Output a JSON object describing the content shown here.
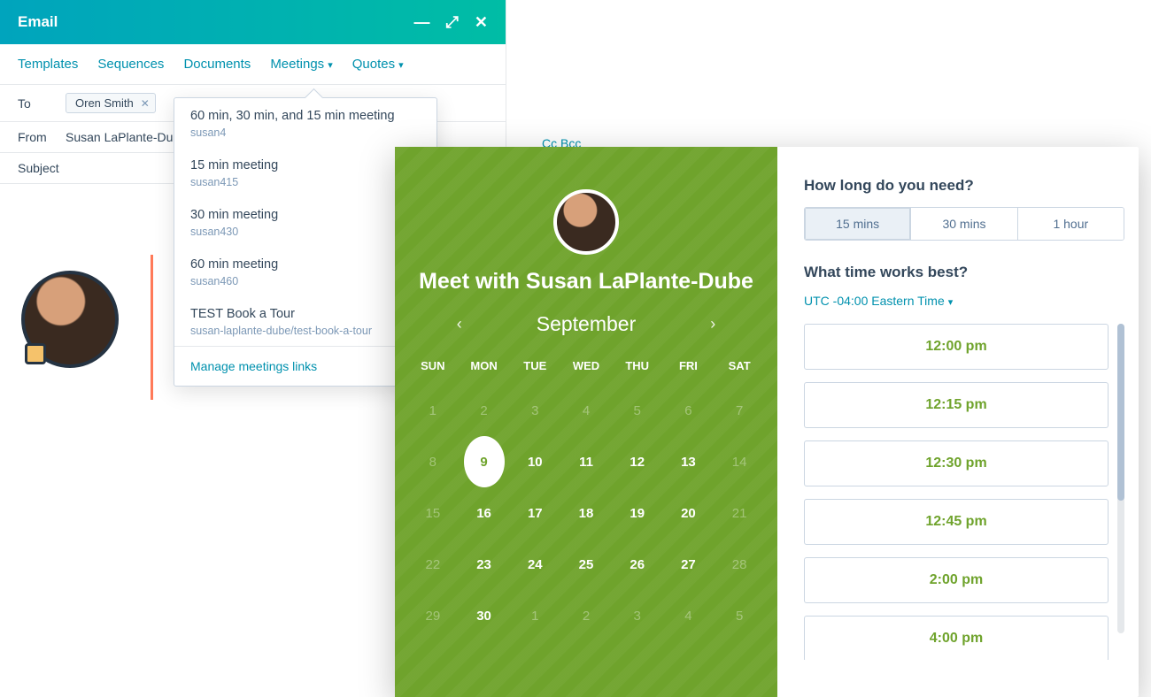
{
  "email": {
    "title": "Email",
    "toolbar": {
      "templates": "Templates",
      "sequences": "Sequences",
      "documents": "Documents",
      "meetings": "Meetings",
      "quotes": "Quotes"
    },
    "to_label": "To",
    "recipient": "Oren Smith",
    "from_label": "From",
    "from_value": "Susan LaPlante-Dub",
    "subject_label": "Subject",
    "cc_bcc": "Cc Bcc"
  },
  "meetings_dropdown": {
    "items": [
      {
        "title": "60 min, 30 min, and 15 min meeting",
        "sub": "susan4"
      },
      {
        "title": "15 min meeting",
        "sub": "susan415"
      },
      {
        "title": "30 min meeting",
        "sub": "susan430"
      },
      {
        "title": "60 min meeting",
        "sub": "susan460"
      },
      {
        "title": "TEST Book a Tour",
        "sub": "susan-laplante-dube/test-book-a-tour"
      }
    ],
    "manage": "Manage meetings links"
  },
  "booking": {
    "title": "Meet with Susan LaPlante-Dube",
    "month": "September",
    "dow": [
      "SUN",
      "MON",
      "TUE",
      "WED",
      "THU",
      "FRI",
      "SAT"
    ],
    "weeks": [
      [
        {
          "n": "1",
          "dim": true
        },
        {
          "n": "2",
          "dim": true
        },
        {
          "n": "3",
          "dim": true
        },
        {
          "n": "4",
          "dim": true
        },
        {
          "n": "5",
          "dim": true
        },
        {
          "n": "6",
          "dim": true
        },
        {
          "n": "7",
          "dim": true
        }
      ],
      [
        {
          "n": "8",
          "dim": true
        },
        {
          "n": "9",
          "sel": true
        },
        {
          "n": "10",
          "bold": true
        },
        {
          "n": "11",
          "bold": true
        },
        {
          "n": "12",
          "bold": true
        },
        {
          "n": "13",
          "bold": true
        },
        {
          "n": "14",
          "dim": true
        }
      ],
      [
        {
          "n": "15",
          "dim": true
        },
        {
          "n": "16",
          "bold": true
        },
        {
          "n": "17",
          "bold": true
        },
        {
          "n": "18",
          "bold": true
        },
        {
          "n": "19",
          "bold": true
        },
        {
          "n": "20",
          "bold": true
        },
        {
          "n": "21",
          "dim": true
        }
      ],
      [
        {
          "n": "22",
          "dim": true
        },
        {
          "n": "23",
          "bold": true
        },
        {
          "n": "24",
          "bold": true
        },
        {
          "n": "25",
          "bold": true
        },
        {
          "n": "26",
          "bold": true
        },
        {
          "n": "27",
          "bold": true
        },
        {
          "n": "28",
          "dim": true
        }
      ],
      [
        {
          "n": "29",
          "dim": true
        },
        {
          "n": "30",
          "bold": true
        },
        {
          "n": "1",
          "dim": true
        },
        {
          "n": "2",
          "dim": true
        },
        {
          "n": "3",
          "dim": true
        },
        {
          "n": "4",
          "dim": true
        },
        {
          "n": "5",
          "dim": true
        }
      ]
    ],
    "duration_heading": "How long do you need?",
    "durations": [
      "15 mins",
      "30 mins",
      "1 hour"
    ],
    "duration_active": 0,
    "time_heading": "What time works best?",
    "timezone": "UTC -04:00 Eastern Time",
    "slots": [
      "12:00 pm",
      "12:15 pm",
      "12:30 pm",
      "12:45 pm",
      "2:00 pm",
      "4:00 pm"
    ]
  }
}
